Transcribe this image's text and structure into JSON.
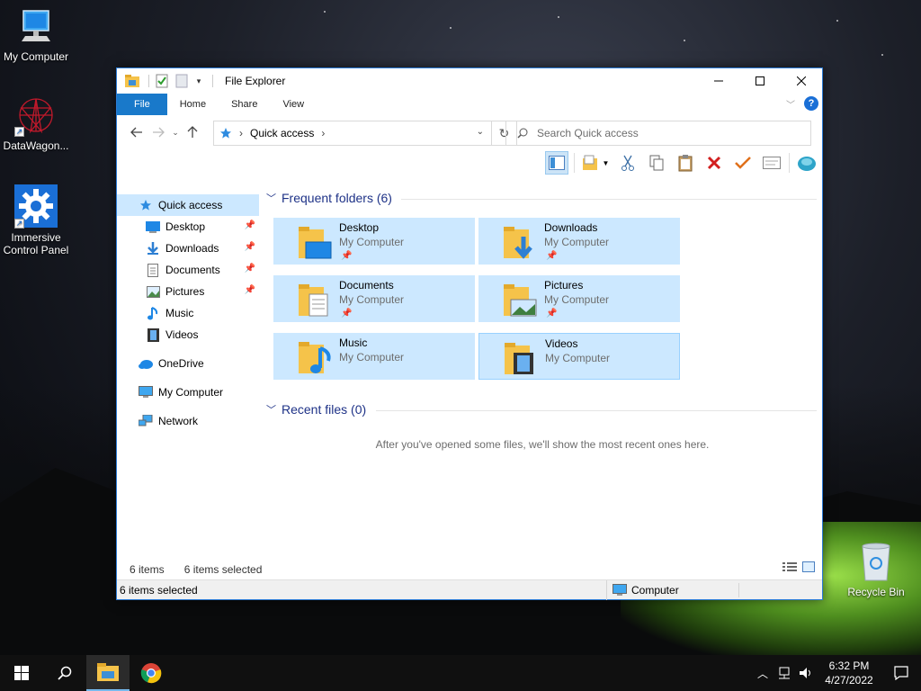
{
  "desktop": {
    "icons": [
      {
        "label": "My Computer"
      },
      {
        "label": "DataWagon..."
      },
      {
        "label": "Immersive Control Panel"
      },
      {
        "label": "Recycle Bin"
      }
    ]
  },
  "window": {
    "title": "File Explorer",
    "ribbon_tabs": [
      "File",
      "Home",
      "Share",
      "View"
    ],
    "help": "?",
    "address": {
      "location": "Quick access"
    },
    "search": {
      "placeholder": "Search Quick access"
    },
    "nav": {
      "quick_access": "Quick access",
      "pinned": [
        {
          "label": "Desktop",
          "pinned": true
        },
        {
          "label": "Downloads",
          "pinned": true
        },
        {
          "label": "Documents",
          "pinned": true
        },
        {
          "label": "Pictures",
          "pinned": true
        },
        {
          "label": "Music",
          "pinned": false
        },
        {
          "label": "Videos",
          "pinned": false
        }
      ],
      "onedrive": "OneDrive",
      "computer": "My Computer",
      "network": "Network"
    },
    "frequent": {
      "header": "Frequent folders (6)",
      "tiles": [
        {
          "name": "Desktop",
          "location": "My Computer",
          "pinned": true
        },
        {
          "name": "Downloads",
          "location": "My Computer",
          "pinned": true
        },
        {
          "name": "Documents",
          "location": "My Computer",
          "pinned": true
        },
        {
          "name": "Pictures",
          "location": "My Computer",
          "pinned": true
        },
        {
          "name": "Music",
          "location": "My Computer",
          "pinned": false
        },
        {
          "name": "Videos",
          "location": "My Computer",
          "pinned": false
        }
      ]
    },
    "recent": {
      "header": "Recent files (0)",
      "empty_message": "After you've opened some files, we'll show the most recent ones here."
    },
    "status": {
      "items": "6 items",
      "selected": "6 items selected",
      "bottom_selected": "6 items selected",
      "bottom_location": "Computer"
    }
  },
  "taskbar": {
    "time": "6:32 PM",
    "date": "4/27/2022"
  },
  "colors": {
    "accent": "#1979ca",
    "selection": "#cce8ff",
    "group_header": "#1e3287"
  }
}
